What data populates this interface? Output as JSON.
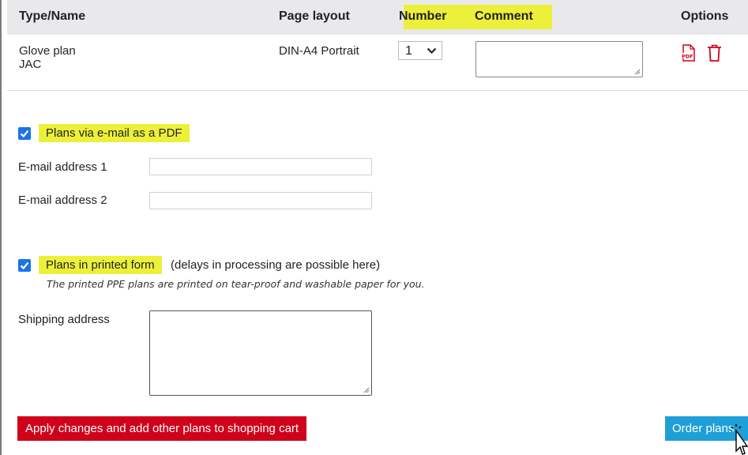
{
  "table": {
    "headers": {
      "type_name": "Type/Name",
      "page_layout": "Page layout",
      "number": "Number",
      "comment": "Comment",
      "options": "Options"
    },
    "row": {
      "name_line1": "Glove plan",
      "name_line2": "JAC",
      "page_layout": "DIN-A4 Portrait",
      "number_selected": "1",
      "comment_value": ""
    }
  },
  "email_section": {
    "checked": true,
    "label": "Plans via e-mail as a PDF",
    "email1_label": "E-mail address 1",
    "email1_value": "",
    "email2_label": "E-mail address 2",
    "email2_value": ""
  },
  "print_section": {
    "checked": true,
    "label": "Plans in printed form",
    "label_suffix": "(delays in processing are possible here)",
    "note": "The printed PPE plans are printed on tear-proof and washable paper for you.",
    "shipping_label": "Shipping address",
    "shipping_value": ""
  },
  "buttons": {
    "apply_label": "Apply changes and add other plans to shopping cart",
    "order_label": "Order plans"
  },
  "colors": {
    "highlight": "#ecf03a",
    "checkbox_blue": "#1a73e8",
    "apply_red": "#d0021b",
    "order_blue": "#1e9fd8",
    "icon_red": "#d0021b"
  },
  "icons": {
    "pdf": "pdf-icon",
    "delete": "trash-icon",
    "dropdown": "chevron-down-icon",
    "cursor": "pointer-cursor-icon"
  }
}
